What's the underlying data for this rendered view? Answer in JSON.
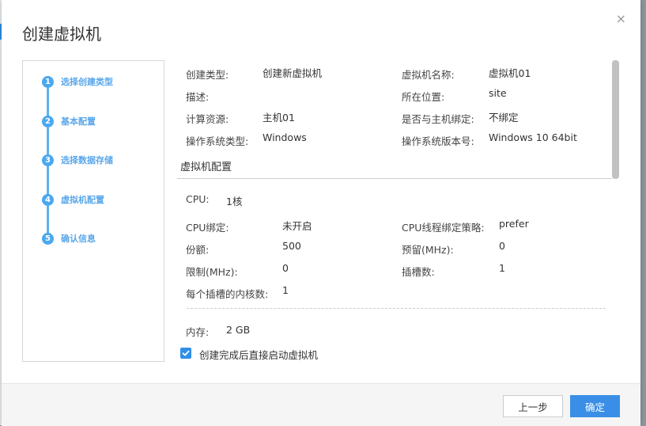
{
  "dialog": {
    "title": "创建虚拟机",
    "close_icon": "×"
  },
  "steps": [
    {
      "num": "1",
      "label": "选择创建类型"
    },
    {
      "num": "2",
      "label": "基本配置"
    },
    {
      "num": "3",
      "label": "选择数据存储"
    },
    {
      "num": "4",
      "label": "虚拟机配置"
    },
    {
      "num": "5",
      "label": "确认信息"
    }
  ],
  "summary": {
    "create_type_label": "创建类型:",
    "create_type_value": "创建新虚拟机",
    "vm_name_label": "虚拟机名称:",
    "vm_name_value": "虚拟机01",
    "desc_label": "描述:",
    "desc_value": "",
    "location_label": "所在位置:",
    "location_value": "site",
    "compute_label": "计算资源:",
    "compute_value": "主机01",
    "bind_host_label": "是否与主机绑定:",
    "bind_host_value": "不绑定",
    "os_type_label": "操作系统类型:",
    "os_type_value": "Windows",
    "os_version_label": "操作系统版本号:",
    "os_version_value": "Windows 10 64bit"
  },
  "vm_config": {
    "section_title": "虚拟机配置",
    "cpu_label": "CPU:",
    "cpu_value": "1核",
    "cpu_bind_label": "CPU绑定:",
    "cpu_bind_value": "未开启",
    "cpu_thread_label": "CPU线程绑定策略:",
    "cpu_thread_value": "prefer",
    "share_label": "份额:",
    "share_value": "500",
    "reserve_label": "预留(MHz):",
    "reserve_value": "0",
    "limit_label": "限制(MHz):",
    "limit_value": "0",
    "slots_label": "插槽数:",
    "slots_value": "1",
    "cores_label": "每个插槽的内核数:",
    "cores_value": "1",
    "memory_label": "内存:",
    "memory_value": "2 GB"
  },
  "start_after_create": {
    "checked": true,
    "label": "创建完成后直接启动虚拟机"
  },
  "footer": {
    "prev_label": "上一步",
    "ok_label": "确定"
  },
  "colors": {
    "accent": "#3a8ee6",
    "step": "#4aa8ef"
  }
}
